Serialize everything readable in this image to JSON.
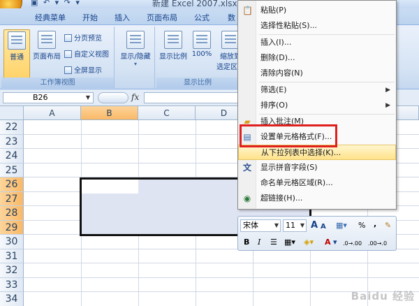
{
  "window": {
    "title": "新建 Excel 2007.xlsx",
    "qat_glyphs": "▣ ↶ ▾ ↷ ▾"
  },
  "tabs": [
    {
      "label": "经典菜单"
    },
    {
      "label": "开始"
    },
    {
      "label": "插入"
    },
    {
      "label": "页面布局"
    },
    {
      "label": "公式"
    },
    {
      "label": "数"
    }
  ],
  "ribbon": {
    "workbook_views": {
      "label": "工作簿视图",
      "normal": "普通",
      "page_layout": "页面布局",
      "page_break_preview": "分页预览",
      "custom_views": "自定义视图",
      "full_screen": "全屏显示"
    },
    "show_hide": {
      "label": "显示/隐藏"
    },
    "zoom": {
      "label": "显示比例",
      "zoom": "显示比例",
      "hundred": "100%",
      "zoom_to_selection_1": "缩放到",
      "zoom_to_selection_2": "选定区域"
    }
  },
  "formula_bar": {
    "name_box": "B26",
    "fx": "fx"
  },
  "columns": [
    "A",
    "B",
    "C",
    "D"
  ],
  "rows": [
    "22",
    "23",
    "24",
    "25",
    "26",
    "27",
    "28",
    "29",
    "30",
    "31",
    "32",
    "33",
    "34"
  ],
  "selected_rows": [
    "26",
    "27",
    "28",
    "29"
  ],
  "context_menu": {
    "items": [
      {
        "label": "粘贴(P)",
        "icon": "clipboard-icon"
      },
      {
        "label": "选择性粘贴(S)..."
      },
      {
        "label": "插入(I)..."
      },
      {
        "label": "删除(D)..."
      },
      {
        "label": "清除内容(N)"
      },
      {
        "label": "筛选(E)",
        "submenu": true
      },
      {
        "label": "排序(O)",
        "submenu": true
      },
      {
        "label": "插入批注(M)",
        "icon": "comment-icon"
      },
      {
        "label": "设置单元格格式(F)...",
        "icon": "format-cells-icon"
      },
      {
        "label": "从下拉列表中选择(K)..."
      },
      {
        "label": "显示拼音字段(S)",
        "icon": "phonetic-icon"
      },
      {
        "label": "命名单元格区域(R)..."
      },
      {
        "label": "超链接(H)...",
        "icon": "hyperlink-icon"
      }
    ],
    "highlighted": "从下拉列表中选择(K)..."
  },
  "mini_toolbar": {
    "font": "宋体",
    "size": "11",
    "grow": "A",
    "shrink": "A",
    "percent": "%",
    "comma": ",",
    "bold": "B",
    "italic": "I",
    "font_color": "A",
    "inc_decimal": ".0→.00",
    "dec_decimal": ".00→.0"
  },
  "watermark": "Baidu 经验",
  "colors": {
    "highlight_box": "#e0201e",
    "selected_header": "#f9b967",
    "selection_fill": "#dfe4f3"
  }
}
